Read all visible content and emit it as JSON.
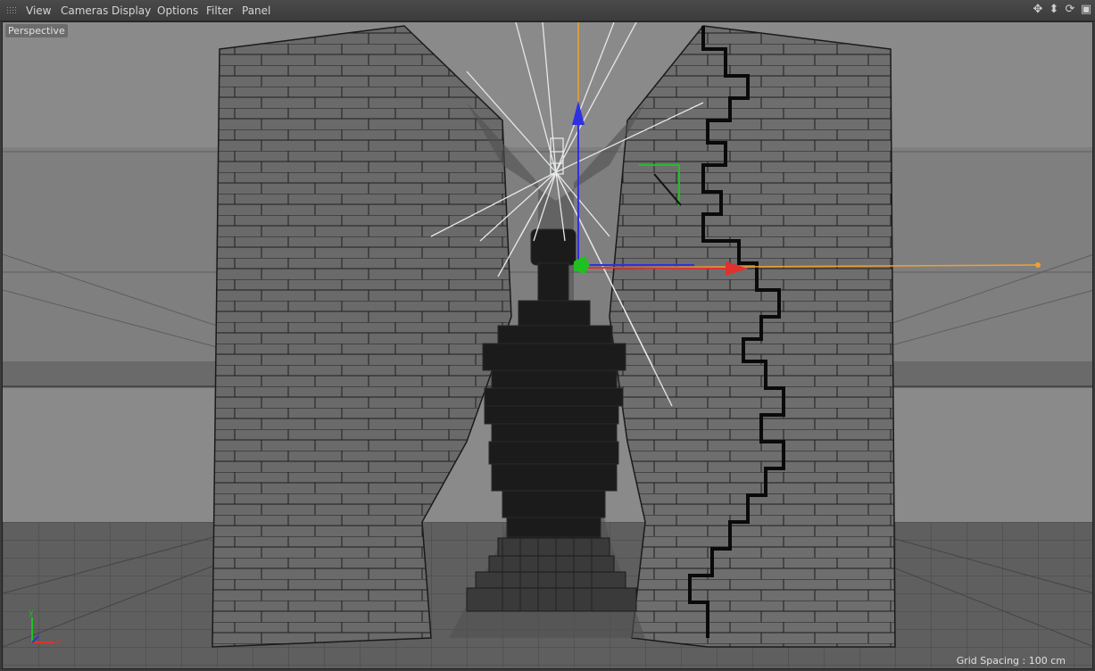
{
  "menu": {
    "items": [
      {
        "label": "View"
      },
      {
        "label": "Cameras"
      },
      {
        "label": "Display"
      },
      {
        "label": "Options"
      },
      {
        "label": "Filter"
      },
      {
        "label": "Panel"
      }
    ]
  },
  "window_controls": [
    {
      "icon": "move-icon",
      "glyph": "✥"
    },
    {
      "icon": "down-arrow-icon",
      "glyph": "⬍"
    },
    {
      "icon": "rotate-icon",
      "glyph": "⟳"
    },
    {
      "icon": "maximize-icon",
      "glyph": "▣"
    }
  ],
  "viewport": {
    "label": "Perspective",
    "grid_spacing": "Grid Spacing : 100 cm",
    "axis_x": "x",
    "axis_y": "y"
  },
  "colors": {
    "background": "#8a8a8a",
    "wall": "#6b6b6b",
    "edge": "#1e1e1e",
    "axis_x": "#e03030",
    "axis_y": "#20c020",
    "axis_z": "#3030e0",
    "orange_line": "#f0a030",
    "spot_lines": "#e8e8e8"
  }
}
